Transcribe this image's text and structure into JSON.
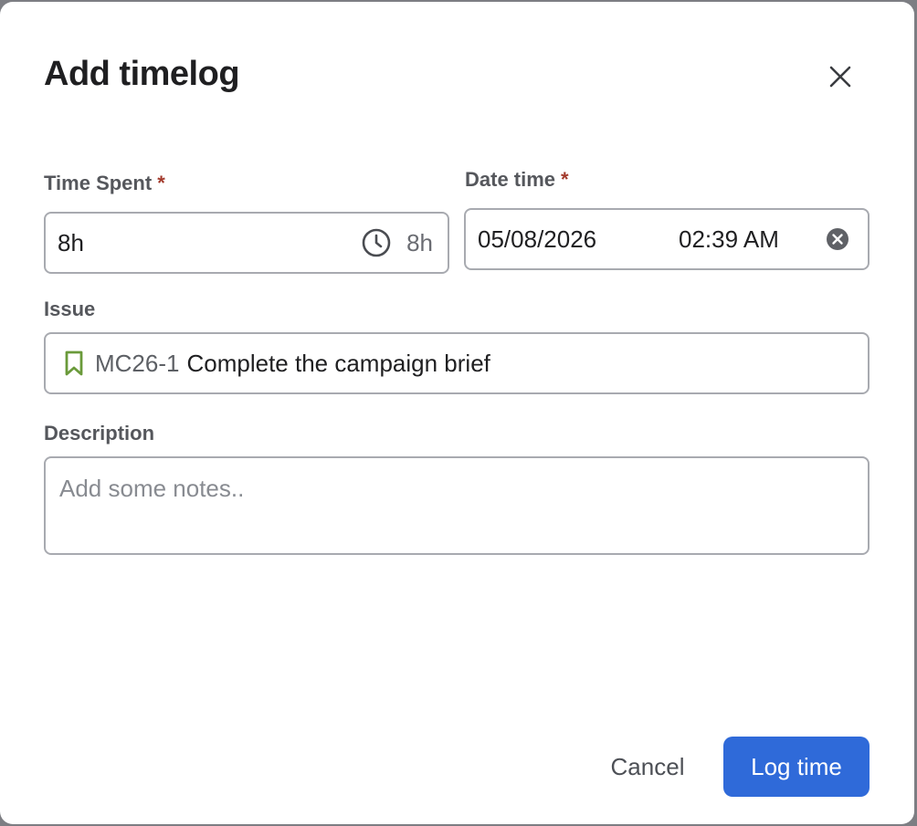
{
  "dialog": {
    "title": "Add timelog",
    "close_icon": "close-icon"
  },
  "time_spent": {
    "label": "Time Spent",
    "required_mark": "*",
    "value": "8h",
    "suffix_icon": "clock-icon",
    "suffix_value": "8h"
  },
  "date_time": {
    "label": "Date time",
    "required_mark": "*",
    "date": "05/08/2026",
    "time": "02:39 AM",
    "clear_icon": "clear-circle-icon"
  },
  "issue": {
    "label": "Issue",
    "icon": "bookmark-icon",
    "icon_color": "#6a9a3a",
    "key": "MC26-1",
    "summary": "Complete the campaign brief"
  },
  "description": {
    "label": "Description",
    "placeholder": "Add some notes.."
  },
  "actions": {
    "cancel_label": "Cancel",
    "submit_label": "Log time",
    "submit_color": "#2f6ad9"
  }
}
